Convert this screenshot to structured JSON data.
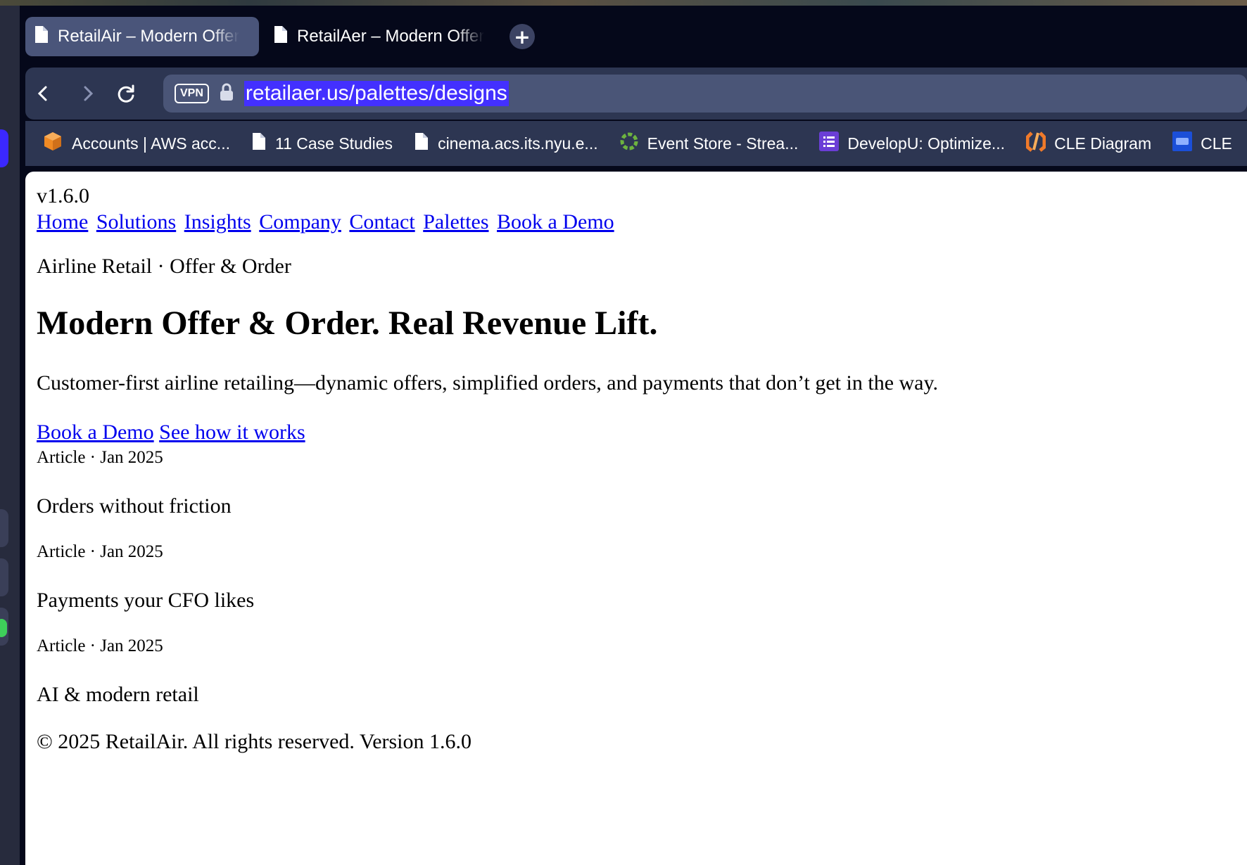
{
  "browser": {
    "tabs": [
      {
        "title": "RetailAir – Modern Offer",
        "active": true
      },
      {
        "title": "RetailAer – Modern Offer",
        "active": false
      }
    ],
    "new_tab_symbol": "+",
    "toolbar": {
      "vpn_label": "VPN",
      "url": "retailaer.us/palettes/designs"
    },
    "bookmarks": [
      {
        "label": "Accounts | AWS acc...",
        "icon": "aws-cube-icon"
      },
      {
        "label": "11 Case Studies",
        "icon": "document-icon"
      },
      {
        "label": "cinema.acs.its.nyu.e...",
        "icon": "document-icon"
      },
      {
        "label": "Event Store - Strea...",
        "icon": "eventstore-ring-icon"
      },
      {
        "label": "DevelopU: Optimize...",
        "icon": "list-icon"
      },
      {
        "label": "CLE Diagram",
        "icon": "cle-diagram-icon"
      },
      {
        "label": "CLE",
        "icon": "cpp-icon"
      }
    ],
    "colors": {
      "chrome_bg": "#05081a",
      "toolbar_bg": "#2d3652",
      "url_highlight": "#4330ff",
      "link": "#0000ee"
    }
  },
  "page": {
    "version": "v1.6.0",
    "nav_links": [
      "Home",
      "Solutions",
      "Insights",
      "Company",
      "Contact",
      "Palettes",
      "Book a Demo"
    ],
    "eyebrow": "Airline Retail · Offer & Order",
    "headline": "Modern Offer & Order. Real Revenue Lift.",
    "subtitle": "Customer-first airline retailing—dynamic offers, simplified orders, and payments that don’t get in the way.",
    "cta_primary": "Book a Demo",
    "cta_secondary": "See how it works",
    "articles": [
      {
        "meta": "Article · Jan 2025",
        "title": "Orders without friction"
      },
      {
        "meta": "Article · Jan 2025",
        "title": "Payments your CFO likes"
      },
      {
        "meta": "Article · Jan 2025",
        "title": "AI & modern retail"
      }
    ],
    "footer": "© 2025 RetailAir. All rights reserved. Version 1.6.0"
  }
}
